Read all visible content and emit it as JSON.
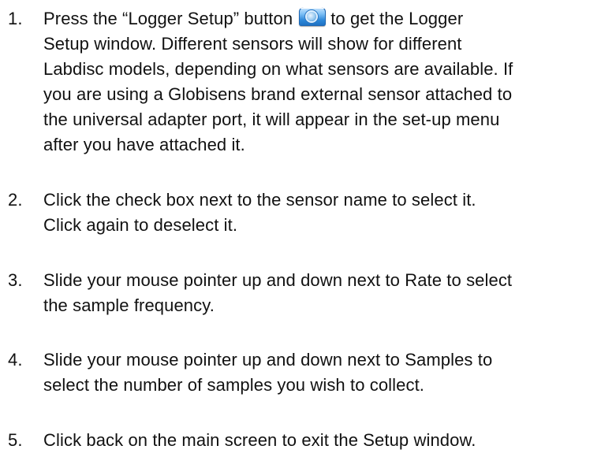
{
  "steps": [
    {
      "number": "1.",
      "lines": [
        "Press the “Logger Setup” button",
        "to get the Logger",
        "Setup window.  Different sensors will show for different",
        "Labdisc models, depending on what sensors are available.  If",
        "you are using a Globisens brand external sensor attached to",
        "the universal adapter port, it will appear in the set-up menu",
        "after you have attached it."
      ],
      "icon": "logger-setup-icon"
    },
    {
      "number": "2.",
      "lines": [
        "Click the check box next to the sensor name to select it.",
        "Click again to deselect it."
      ]
    },
    {
      "number": "3.",
      "lines": [
        "Slide your mouse pointer up and down next to Rate to select",
        "the sample frequency."
      ]
    },
    {
      "number": "4.",
      "lines": [
        "Slide your mouse pointer up and down next to Samples to",
        "select the number of samples you wish to collect."
      ]
    },
    {
      "number": "5.",
      "lines": [
        "Click back on the main screen to exit the Setup window."
      ]
    }
  ]
}
